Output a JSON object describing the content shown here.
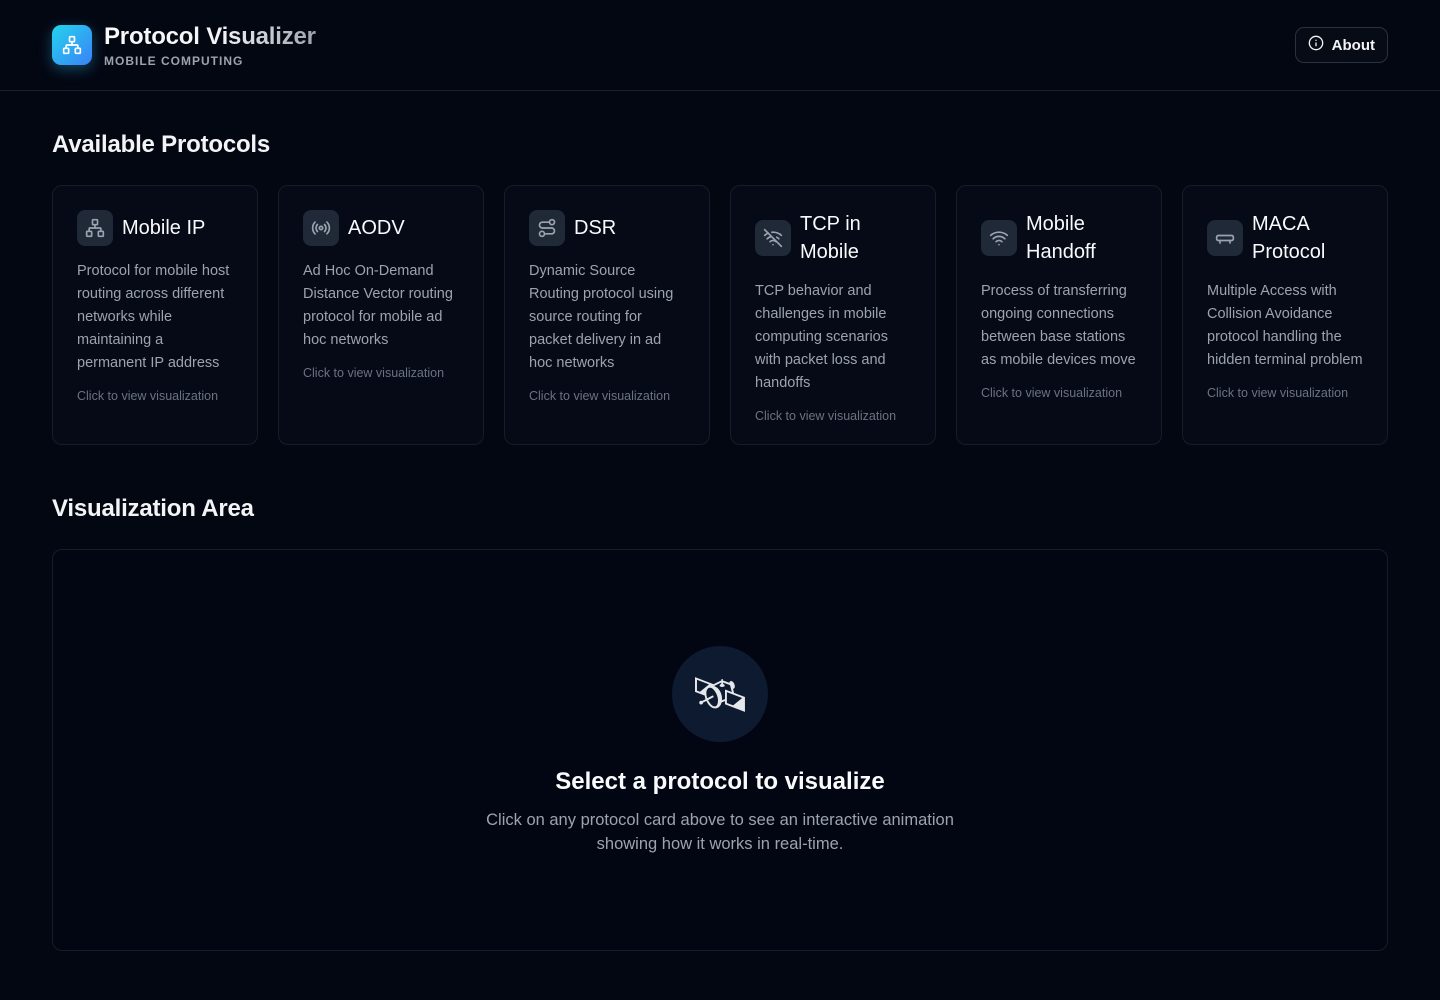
{
  "app": {
    "title": "Protocol Visualizer",
    "subtitle": "MOBILE COMPUTING",
    "about_label": "About"
  },
  "protocols": {
    "section_title": "Available Protocols",
    "cards": [
      {
        "title": "Mobile IP",
        "icon": "network-icon",
        "description": "Protocol for mobile host routing across different networks while maintaining a permanent IP address",
        "hint": "Click to view visualization"
      },
      {
        "title": "AODV",
        "icon": "radio-broadcast-icon",
        "description": "Ad Hoc On-Demand Distance Vector routing protocol for mobile ad hoc networks",
        "hint": "Click to view visualization"
      },
      {
        "title": "DSR",
        "icon": "route-icon",
        "description": "Dynamic Source Routing protocol using source routing for packet delivery in ad hoc networks",
        "hint": "Click to view visualization"
      },
      {
        "title": "TCP in Mobile",
        "icon": "wifi-off-icon",
        "description": "TCP behavior and challenges in mobile computing scenarios with packet loss and handoffs",
        "hint": "Click to view visualization"
      },
      {
        "title": "Mobile Handoff",
        "icon": "wifi-icon",
        "description": "Process of transferring ongoing connections between base stations as mobile devices move",
        "hint": "Click to view visualization"
      },
      {
        "title": "MACA Protocol",
        "icon": "router-icon",
        "description": "Multiple Access with Collision Avoidance protocol handling the hidden terminal problem",
        "hint": "Click to view visualization"
      }
    ]
  },
  "visualization": {
    "section_title": "Visualization Area",
    "icon": "🛰",
    "empty_title": "Select a protocol to visualize",
    "empty_text": "Click on any protocol card above to see an interactive animation showing how it works in real-time."
  },
  "colors": {
    "background": "#030712",
    "card_bg": "#050a16",
    "accent_start": "#22d3ee",
    "accent_end": "#3b82f6"
  }
}
